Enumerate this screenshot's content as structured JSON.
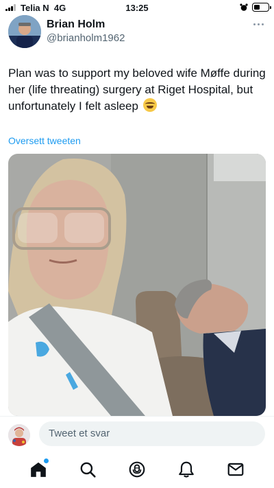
{
  "status_bar": {
    "carrier": "Telia N",
    "network": "4G",
    "time": "13:25"
  },
  "author": {
    "display_name": "Brian Holm",
    "handle": "@brianholm1962"
  },
  "tweet": {
    "text": "Plan was to support my beloved wife Møffe during her (life threating) surgery at Riget Hospital, but unfortunately I felt asleep",
    "emoji": "face-with-tears-of-joy-icon",
    "translate_label": "Oversett tweeten"
  },
  "reply": {
    "placeholder": "Tweet et svar"
  },
  "tab_bar": {
    "items": [
      {
        "icon": "home-icon",
        "active": true,
        "has_notification_dot": true
      },
      {
        "icon": "search-icon",
        "active": false
      },
      {
        "icon": "spaces-icon",
        "active": false
      },
      {
        "icon": "notifications-icon",
        "active": false
      },
      {
        "icon": "messages-icon",
        "active": false
      }
    ]
  },
  "colors": {
    "accent": "#1d9bf0",
    "text": "#0f1419",
    "secondary_text": "#536471",
    "input_background": "#eff3f4"
  }
}
